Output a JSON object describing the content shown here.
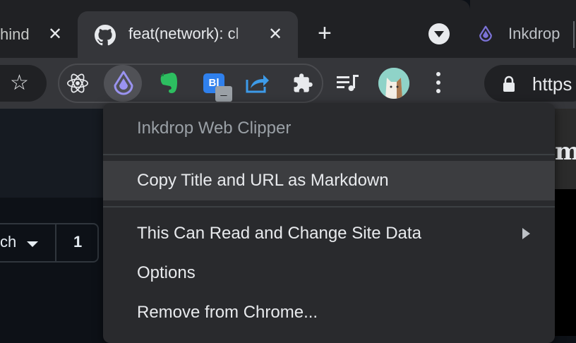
{
  "left_window": {
    "tabs": [
      {
        "label": "hind",
        "close": "✕"
      },
      {
        "label": "feat(network): cl",
        "close": "✕",
        "icon": "github-icon"
      }
    ],
    "new_tab": "+",
    "toolbar": {
      "extensions": [
        "react-devtools-icon",
        "inkdrop-icon",
        "evernote-icon",
        "bl-icon",
        "share-icon",
        "puzzle-icon"
      ],
      "badge": "_"
    },
    "page": {
      "branch_label": "ch",
      "count": "1"
    }
  },
  "right_window": {
    "tab_label": "Inkdrop",
    "address": "https",
    "content_char": "m"
  },
  "context_menu": {
    "title": "Inkdrop Web Clipper",
    "items": [
      {
        "label": "Copy Title and URL as Markdown",
        "highlighted": true
      },
      {
        "label": "This Can Read and Change Site Data",
        "submenu": true
      },
      {
        "label": "Options"
      },
      {
        "label": "Remove from Chrome..."
      }
    ]
  },
  "colors": {
    "tab_strip": "#202124",
    "toolbar": "#35363a",
    "menu_bg": "#292a2d",
    "menu_highlight": "#3c3d40",
    "inkdrop_purple": "#7b72d6"
  }
}
